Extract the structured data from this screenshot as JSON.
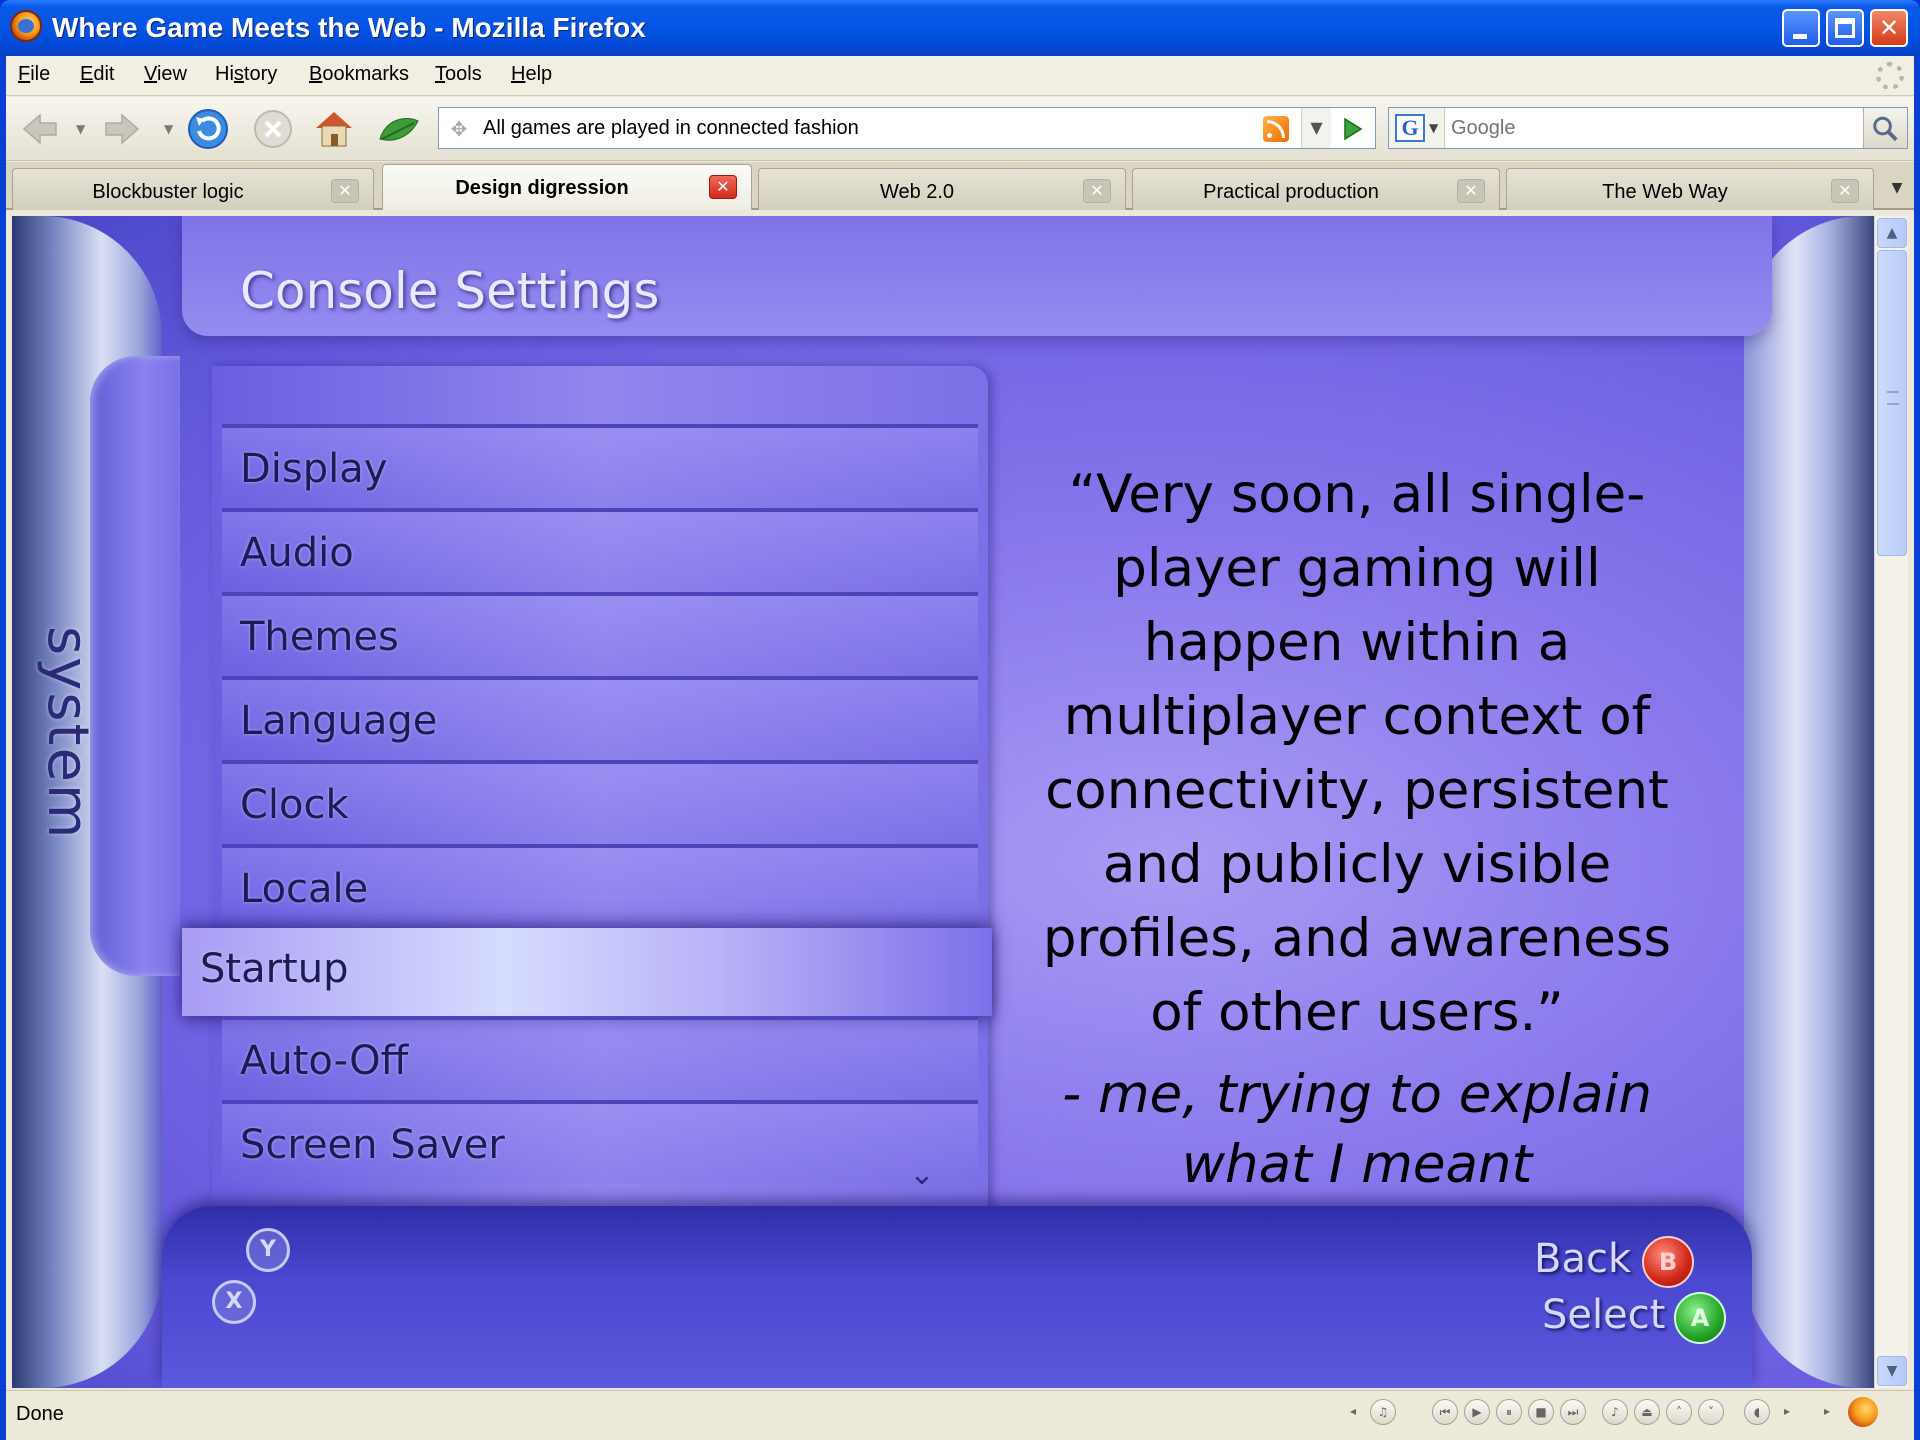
{
  "window": {
    "title": "Where Game Meets the Web - Mozilla Firefox",
    "controls": {
      "minimize": "",
      "maximize": "",
      "close": "✕"
    }
  },
  "menubar": {
    "items": [
      {
        "label": "File",
        "ul": "F",
        "rest": "ile"
      },
      {
        "label": "Edit",
        "ul": "E",
        "rest": "dit"
      },
      {
        "label": "View",
        "ul": "V",
        "rest": "iew"
      },
      {
        "label": "History",
        "pre": "Hi",
        "ul": "s",
        "rest": "tory"
      },
      {
        "label": "Bookmarks",
        "ul": "B",
        "rest": "ookmarks"
      },
      {
        "label": "Tools",
        "ul": "T",
        "rest": "ools"
      },
      {
        "label": "Help",
        "ul": "H",
        "rest": "elp"
      }
    ]
  },
  "navbar": {
    "url": "All games are played in connected fashion",
    "search_placeholder": "Google",
    "search_engine_letter": "G"
  },
  "tabs": [
    {
      "label": "Blockbuster logic",
      "active": false
    },
    {
      "label": "Design digression",
      "active": true
    },
    {
      "label": "Web 2.0",
      "active": false
    },
    {
      "label": "Practical production",
      "active": false
    },
    {
      "label": "The Web Way",
      "active": false
    }
  ],
  "page": {
    "side_tab": "system",
    "header": "Console Settings",
    "menu": [
      "Display",
      "Audio",
      "Themes",
      "Language",
      "Clock",
      "Locale",
      "Startup",
      "Auto-Off",
      "Screen Saver"
    ],
    "selected_item": "Startup",
    "quote": "“Very soon, all single-player gaming will happen within a multiplayer context of connectivity, persistent and publicly visible profiles, and awareness of other users.”",
    "quote_lines": [
      "“Very soon, all single-",
      "player gaming will",
      "happen within a",
      "multiplayer context of",
      "connectivity, persistent",
      "and publicly visible",
      "profiles, and awareness",
      "of other users.”"
    ],
    "attribution_lines": [
      "- me, trying to explain",
      "what I meant"
    ],
    "footer": {
      "y_button": "Y",
      "x_button": "X",
      "back_label": "Back",
      "back_button": "B",
      "select_label": "Select",
      "select_button": "A"
    }
  },
  "statusbar": {
    "text": "Done"
  },
  "colors": {
    "titlebar": "#0554e3",
    "chrome": "#ece9d8",
    "dashboard_purple": "#8878ec",
    "b_button": "#d2261a",
    "a_button": "#25a42a"
  }
}
